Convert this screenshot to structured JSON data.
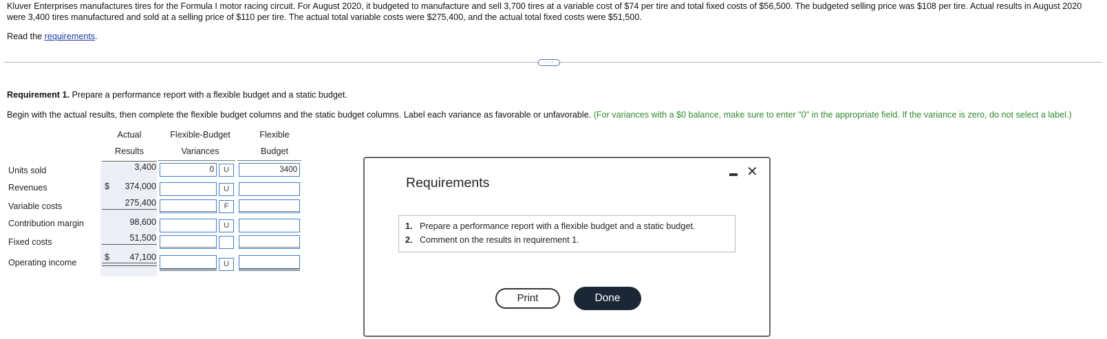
{
  "intro": "Kluver Enterprises manufactures tires for the Formula I motor racing circuit. For August 2020, it budgeted to manufacture and sell 3,700 tires at a variable cost of $74 per tire and total fixed costs of $56,500. The budgeted selling price was $108 per tire. Actual results in August 2020 were 3,400 tires manufactured and sold at a selling price of $110 per tire. The actual total variable costs were $275,400, and the actual total fixed costs were $51,500.",
  "read": {
    "prefix": "Read the ",
    "link": "requirements",
    "suffix": "."
  },
  "more_button": "····",
  "requirement1": {
    "bold": "Requirement 1.",
    "text": " Prepare a performance report with a flexible budget and a static budget."
  },
  "instructions": {
    "main": "Begin with the actual results, then complete the flexible budget columns and the static budget columns. Label each variance as favorable or unfavorable. ",
    "green": "(For variances with a $0 balance, make sure to enter \"0\" in the appropriate field. If the variance is zero, do not select a label.)"
  },
  "headers": {
    "actual_1": "Actual",
    "actual_2": "Results",
    "fbv_1": "Flexible-Budget",
    "fbv_2": "Variances",
    "flex_1": "Flexible",
    "flex_2": "Budget"
  },
  "rows": [
    {
      "label": "Units sold",
      "dollar": "",
      "actual": "3,400",
      "variance": "0",
      "fu": "U",
      "flex": "3400"
    },
    {
      "label": "Revenues",
      "dollar": "$",
      "actual": "374,000",
      "variance": "",
      "fu": "U",
      "flex": ""
    },
    {
      "label": "Variable costs",
      "dollar": "",
      "actual": "275,400",
      "variance": "",
      "fu": "F",
      "flex": ""
    },
    {
      "label": "Contribution margin",
      "dollar": "",
      "actual": "98,600",
      "variance": "",
      "fu": "U",
      "flex": ""
    },
    {
      "label": "Fixed costs",
      "dollar": "",
      "actual": "51,500",
      "variance": "",
      "fu": "",
      "flex": ""
    },
    {
      "label": "Operating income",
      "dollar": "$",
      "actual": "47,100",
      "variance": "",
      "fu": "U",
      "flex": ""
    }
  ],
  "modal": {
    "title": "Requirements",
    "items": [
      {
        "num": "1.",
        "text": "Prepare a performance report with a flexible budget and a static budget."
      },
      {
        "num": "2.",
        "text": "Comment on the results in requirement 1."
      }
    ],
    "print_label": "Print",
    "done_label": "Done",
    "close_icon": "✕"
  }
}
